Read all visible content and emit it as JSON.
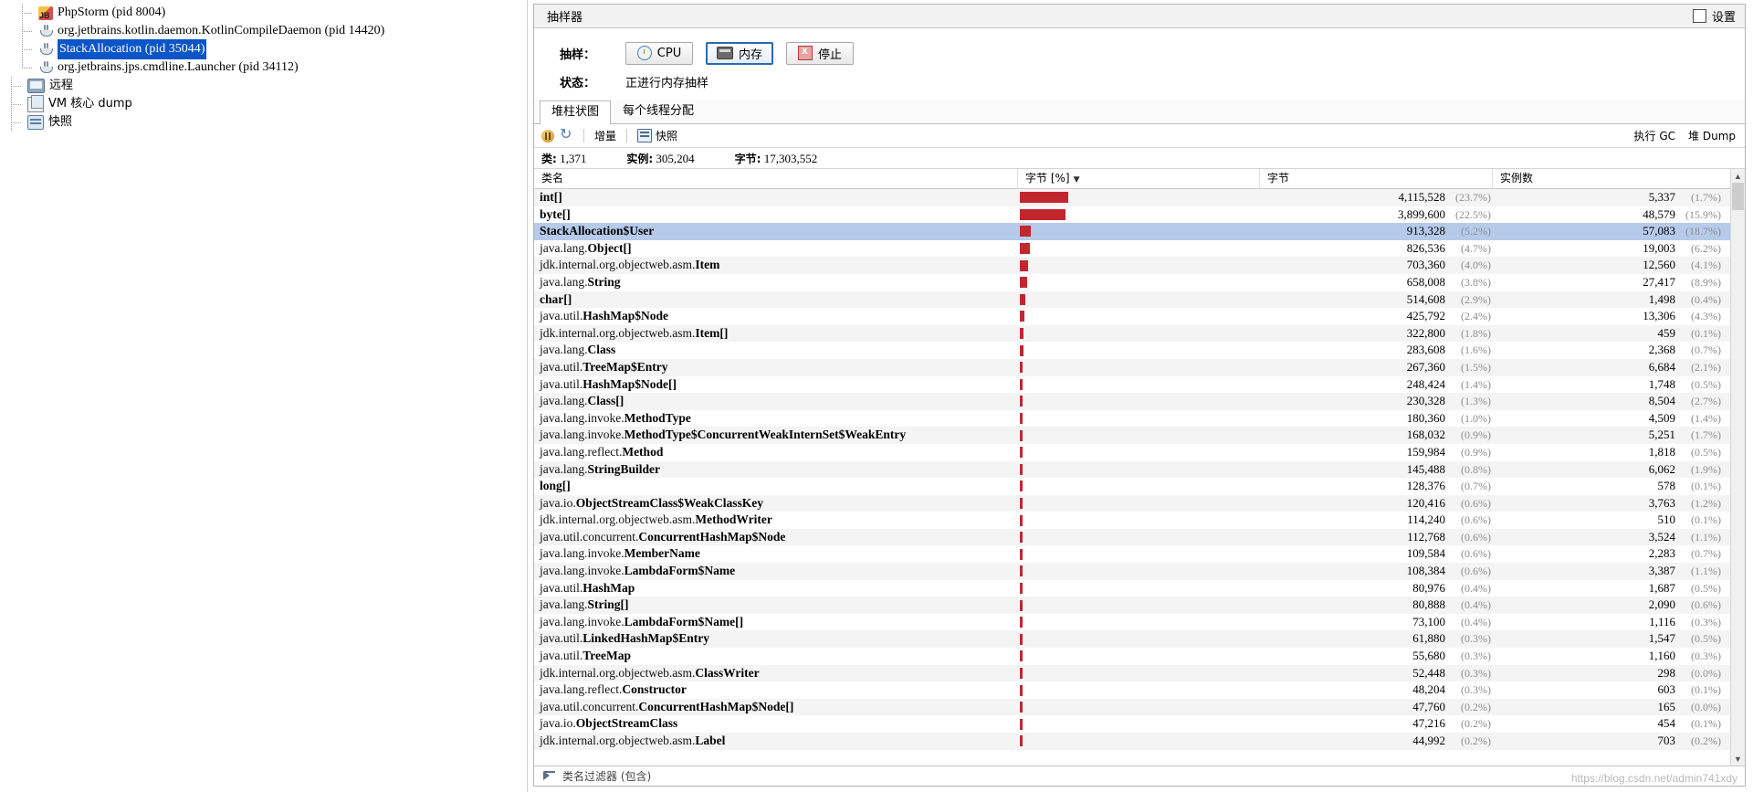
{
  "tree": {
    "items": [
      {
        "label": "PhpStorm (pid 8004)",
        "icon": "phpstorm-icon",
        "indent": 3,
        "selected": false,
        "cjk": false
      },
      {
        "label": "org.jetbrains.kotlin.daemon.KotlinCompileDaemon (pid 14420)",
        "icon": "java-icon",
        "indent": 3,
        "selected": false,
        "cjk": false
      },
      {
        "label": "StackAllocation (pid 35044)",
        "icon": "java-icon",
        "indent": 3,
        "selected": true,
        "cjk": false
      },
      {
        "label": "org.jetbrains.jps.cmdline.Launcher (pid 34112)",
        "icon": "java-icon",
        "indent": 3,
        "selected": false,
        "cjk": false
      },
      {
        "label": "远程",
        "icon": "remote-icon",
        "indent": 2,
        "selected": false,
        "cjk": true
      },
      {
        "label": "VM 核心 dump",
        "icon": "vm-dump-icon",
        "indent": 2,
        "selected": false,
        "cjk": true
      },
      {
        "label": "快照",
        "icon": "snapshot-icon",
        "indent": 2,
        "selected": false,
        "cjk": true
      }
    ]
  },
  "panel": {
    "title": "抽样器",
    "settings_label": "设置"
  },
  "sampler": {
    "sample_label": "抽样：",
    "buttons": [
      {
        "label": "CPU",
        "icon": "cpu-icon",
        "active": false
      },
      {
        "label": "内存",
        "icon": "memory-icon",
        "active": true
      },
      {
        "label": "停止",
        "icon": "stop-icon",
        "active": false
      }
    ],
    "status_label": "状态：",
    "status_value": "正进行内存抽样"
  },
  "tabs": [
    {
      "label": "堆柱状图",
      "selected": true
    },
    {
      "label": "每个线程分配",
      "selected": false
    }
  ],
  "toolbar": {
    "pause_icon": "pause-icon",
    "refresh_icon": "refresh-icon",
    "delta_label": "增量",
    "snapshot_label": "快照",
    "snapshot_icon": "snapshot-icon",
    "gc_label": "执行 GC",
    "heapdump_label": "堆 Dump"
  },
  "stats": [
    {
      "label": "类:",
      "value": "1,371"
    },
    {
      "label": "实例:",
      "value": "305,204"
    },
    {
      "label": "字节:",
      "value": "17,303,552"
    }
  ],
  "table": {
    "columns": [
      "类名",
      "字节 [%]",
      "字节",
      "实例数"
    ],
    "sorted_column": 1,
    "sort_dir": "desc",
    "rows": [
      {
        "pkg": "",
        "cls": "int[]",
        "bytes": "4,115,528",
        "bytes_pct": "(23.7%)",
        "insts": "5,337",
        "insts_pct": "(1.7%)",
        "bar": 23.7
      },
      {
        "pkg": "",
        "cls": "byte[]",
        "bytes": "3,899,600",
        "bytes_pct": "(22.5%)",
        "insts": "48,579",
        "insts_pct": "(15.9%)",
        "bar": 22.5
      },
      {
        "pkg": "",
        "cls": "StackAllocation$User",
        "bytes": "913,328",
        "bytes_pct": "(5.2%)",
        "insts": "57,083",
        "insts_pct": "(18.7%)",
        "bar": 5.2,
        "selected": true
      },
      {
        "pkg": "java.lang.",
        "cls": "Object[]",
        "bytes": "826,536",
        "bytes_pct": "(4.7%)",
        "insts": "19,003",
        "insts_pct": "(6.2%)",
        "bar": 4.7
      },
      {
        "pkg": "jdk.internal.org.objectweb.asm.",
        "cls": "Item",
        "bytes": "703,360",
        "bytes_pct": "(4.0%)",
        "insts": "12,560",
        "insts_pct": "(4.1%)",
        "bar": 4.0
      },
      {
        "pkg": "java.lang.",
        "cls": "String",
        "bytes": "658,008",
        "bytes_pct": "(3.8%)",
        "insts": "27,417",
        "insts_pct": "(8.9%)",
        "bar": 3.8
      },
      {
        "pkg": "",
        "cls": "char[]",
        "bytes": "514,608",
        "bytes_pct": "(2.9%)",
        "insts": "1,498",
        "insts_pct": "(0.4%)",
        "bar": 2.9
      },
      {
        "pkg": "java.util.",
        "cls": "HashMap$Node",
        "bytes": "425,792",
        "bytes_pct": "(2.4%)",
        "insts": "13,306",
        "insts_pct": "(4.3%)",
        "bar": 2.4
      },
      {
        "pkg": "jdk.internal.org.objectweb.asm.",
        "cls": "Item[]",
        "bytes": "322,800",
        "bytes_pct": "(1.8%)",
        "insts": "459",
        "insts_pct": "(0.1%)",
        "bar": 1.8
      },
      {
        "pkg": "java.lang.",
        "cls": "Class",
        "bytes": "283,608",
        "bytes_pct": "(1.6%)",
        "insts": "2,368",
        "insts_pct": "(0.7%)",
        "bar": 1.6
      },
      {
        "pkg": "java.util.",
        "cls": "TreeMap$Entry",
        "bytes": "267,360",
        "bytes_pct": "(1.5%)",
        "insts": "6,684",
        "insts_pct": "(2.1%)",
        "bar": 1.5
      },
      {
        "pkg": "java.util.",
        "cls": "HashMap$Node[]",
        "bytes": "248,424",
        "bytes_pct": "(1.4%)",
        "insts": "1,748",
        "insts_pct": "(0.5%)",
        "bar": 1.4
      },
      {
        "pkg": "java.lang.",
        "cls": "Class[]",
        "bytes": "230,328",
        "bytes_pct": "(1.3%)",
        "insts": "8,504",
        "insts_pct": "(2.7%)",
        "bar": 1.3
      },
      {
        "pkg": "java.lang.invoke.",
        "cls": "MethodType",
        "bytes": "180,360",
        "bytes_pct": "(1.0%)",
        "insts": "4,509",
        "insts_pct": "(1.4%)",
        "bar": 1.0
      },
      {
        "pkg": "java.lang.invoke.",
        "cls": "MethodType$ConcurrentWeakInternSet$WeakEntry",
        "bytes": "168,032",
        "bytes_pct": "(0.9%)",
        "insts": "5,251",
        "insts_pct": "(1.7%)",
        "bar": 0.9
      },
      {
        "pkg": "java.lang.reflect.",
        "cls": "Method",
        "bytes": "159,984",
        "bytes_pct": "(0.9%)",
        "insts": "1,818",
        "insts_pct": "(0.5%)",
        "bar": 0.9
      },
      {
        "pkg": "java.lang.",
        "cls": "StringBuilder",
        "bytes": "145,488",
        "bytes_pct": "(0.8%)",
        "insts": "6,062",
        "insts_pct": "(1.9%)",
        "bar": 0.8
      },
      {
        "pkg": "",
        "cls": "long[]",
        "bytes": "128,376",
        "bytes_pct": "(0.7%)",
        "insts": "578",
        "insts_pct": "(0.1%)",
        "bar": 0.7
      },
      {
        "pkg": "java.io.",
        "cls": "ObjectStreamClass$WeakClassKey",
        "bytes": "120,416",
        "bytes_pct": "(0.6%)",
        "insts": "3,763",
        "insts_pct": "(1.2%)",
        "bar": 0.6
      },
      {
        "pkg": "jdk.internal.org.objectweb.asm.",
        "cls": "MethodWriter",
        "bytes": "114,240",
        "bytes_pct": "(0.6%)",
        "insts": "510",
        "insts_pct": "(0.1%)",
        "bar": 0.6
      },
      {
        "pkg": "java.util.concurrent.",
        "cls": "ConcurrentHashMap$Node",
        "bytes": "112,768",
        "bytes_pct": "(0.6%)",
        "insts": "3,524",
        "insts_pct": "(1.1%)",
        "bar": 0.6
      },
      {
        "pkg": "java.lang.invoke.",
        "cls": "MemberName",
        "bytes": "109,584",
        "bytes_pct": "(0.6%)",
        "insts": "2,283",
        "insts_pct": "(0.7%)",
        "bar": 0.6
      },
      {
        "pkg": "java.lang.invoke.",
        "cls": "LambdaForm$Name",
        "bytes": "108,384",
        "bytes_pct": "(0.6%)",
        "insts": "3,387",
        "insts_pct": "(1.1%)",
        "bar": 0.6
      },
      {
        "pkg": "java.util.",
        "cls": "HashMap",
        "bytes": "80,976",
        "bytes_pct": "(0.4%)",
        "insts": "1,687",
        "insts_pct": "(0.5%)",
        "bar": 0.4
      },
      {
        "pkg": "java.lang.",
        "cls": "String[]",
        "bytes": "80,888",
        "bytes_pct": "(0.4%)",
        "insts": "2,090",
        "insts_pct": "(0.6%)",
        "bar": 0.4
      },
      {
        "pkg": "java.lang.invoke.",
        "cls": "LambdaForm$Name[]",
        "bytes": "73,100",
        "bytes_pct": "(0.4%)",
        "insts": "1,116",
        "insts_pct": "(0.3%)",
        "bar": 0.4
      },
      {
        "pkg": "java.util.",
        "cls": "LinkedHashMap$Entry",
        "bytes": "61,880",
        "bytes_pct": "(0.3%)",
        "insts": "1,547",
        "insts_pct": "(0.5%)",
        "bar": 0.3
      },
      {
        "pkg": "java.util.",
        "cls": "TreeMap",
        "bytes": "55,680",
        "bytes_pct": "(0.3%)",
        "insts": "1,160",
        "insts_pct": "(0.3%)",
        "bar": 0.3
      },
      {
        "pkg": "jdk.internal.org.objectweb.asm.",
        "cls": "ClassWriter",
        "bytes": "52,448",
        "bytes_pct": "(0.3%)",
        "insts": "298",
        "insts_pct": "(0.0%)",
        "bar": 0.3
      },
      {
        "pkg": "java.lang.reflect.",
        "cls": "Constructor",
        "bytes": "48,204",
        "bytes_pct": "(0.3%)",
        "insts": "603",
        "insts_pct": "(0.1%)",
        "bar": 0.3
      },
      {
        "pkg": "java.util.concurrent.",
        "cls": "ConcurrentHashMap$Node[]",
        "bytes": "47,760",
        "bytes_pct": "(0.2%)",
        "insts": "165",
        "insts_pct": "(0.0%)",
        "bar": 0.2
      },
      {
        "pkg": "java.io.",
        "cls": "ObjectStreamClass",
        "bytes": "47,216",
        "bytes_pct": "(0.2%)",
        "insts": "454",
        "insts_pct": "(0.1%)",
        "bar": 0.2
      },
      {
        "pkg": "jdk.internal.org.objectweb.asm.",
        "cls": "Label",
        "bytes": "44,992",
        "bytes_pct": "(0.2%)",
        "insts": "703",
        "insts_pct": "(0.2%)",
        "bar": 0.2
      }
    ]
  },
  "footer": {
    "filter_label": "类名过滤器 (包含)",
    "filter_icon": "filter-icon",
    "watermark": "https://blog.csdn.net/admin741xdy"
  },
  "colors": {
    "bar": "#c1272d",
    "selection": "#b6caea",
    "tree_selection": "#0a55c8",
    "accent": "#2a6ab0"
  }
}
